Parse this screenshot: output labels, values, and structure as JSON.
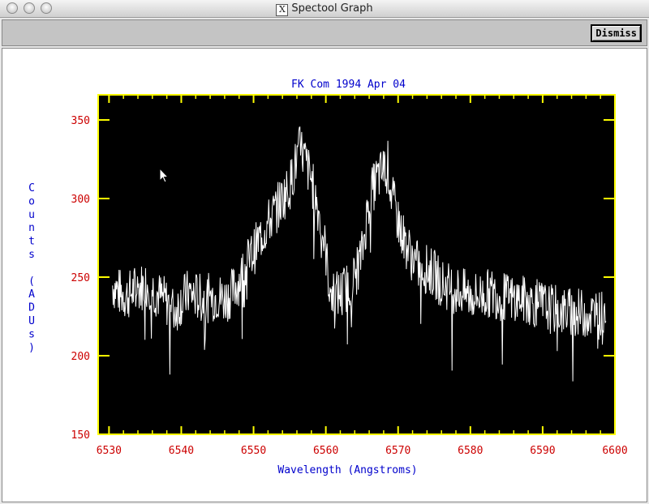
{
  "window": {
    "title": "Spectool Graph"
  },
  "toolbar": {
    "dismiss_label": "Dismiss"
  },
  "colors": {
    "frame": "#ffff00",
    "plot_bg": "#000000",
    "trace": "#ffffff",
    "tick_labels": "#cc0000",
    "titles": "#0000cc"
  },
  "chart_data": {
    "type": "line",
    "title": "FK Com 1994 Apr 04",
    "xlabel": "Wavelength (Angstroms)",
    "ylabel": "Counts (ADUs)",
    "xlim": [
      6528.5,
      6600
    ],
    "ylim": [
      150,
      366
    ],
    "xticks": [
      6530,
      6540,
      6550,
      6560,
      6570,
      6580,
      6590,
      6600
    ],
    "yticks": [
      150,
      200,
      250,
      300,
      350
    ],
    "series": [
      {
        "x": [
          6530.5,
          6531.5,
          6532.5,
          6533.5,
          6534.5,
          6535.5,
          6536.5,
          6537.5,
          6538.5,
          6539,
          6540,
          6541,
          6542,
          6543,
          6544,
          6545,
          6546,
          6547,
          6548,
          6549,
          6550,
          6551,
          6552,
          6553,
          6554,
          6555,
          6556,
          6556.5,
          6557,
          6558,
          6559,
          6560,
          6560.5,
          6561,
          6562,
          6563,
          6564,
          6565,
          6566,
          6567,
          6568,
          6568.5,
          6569,
          6570,
          6571,
          6572,
          6573,
          6574,
          6575,
          6576,
          6577,
          6578,
          6579,
          6580,
          6581,
          6582,
          6583,
          6584,
          6585,
          6586,
          6587,
          6588,
          6589,
          6590,
          6591,
          6592,
          6593,
          6594,
          6595,
          6596,
          6597,
          6598,
          6598.8
        ],
        "y": [
          245,
          240,
          238,
          242,
          244,
          246,
          240,
          236,
          232,
          228,
          235,
          240,
          238,
          236,
          237,
          238,
          236,
          240,
          248,
          258,
          266,
          276,
          284,
          292,
          300,
          308,
          325,
          333,
          326,
          312,
          292,
          266,
          244,
          238,
          240,
          244,
          250,
          265,
          300,
          312,
          318,
          325,
          304,
          286,
          272,
          262,
          256,
          255,
          252,
          246,
          244,
          242,
          240,
          238,
          238,
          239,
          240,
          238,
          237,
          236,
          236,
          235,
          233,
          232,
          230,
          229,
          228,
          228,
          227,
          227,
          226,
          226,
          228
        ]
      }
    ]
  }
}
